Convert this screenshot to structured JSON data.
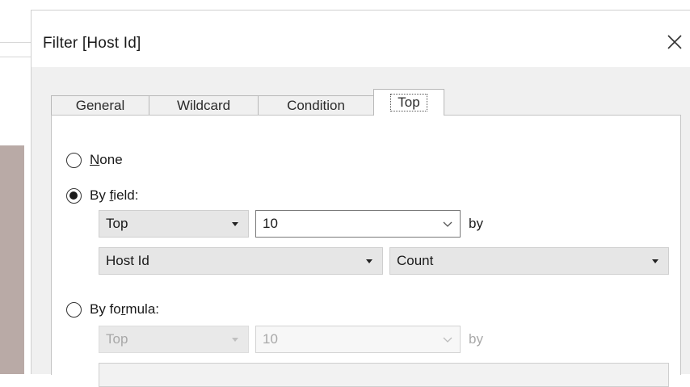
{
  "dialog": {
    "title": "Filter [Host Id]"
  },
  "tabs": [
    {
      "label": "General"
    },
    {
      "label": "Wildcard"
    },
    {
      "label": "Condition"
    },
    {
      "label": "Top",
      "active": true
    }
  ],
  "options": {
    "none": {
      "label_u": "N",
      "label_rest": "one"
    },
    "by_field": {
      "label_pre": "By ",
      "label_u": "f",
      "label_rest": "ield:",
      "checked": true
    },
    "by_formula": {
      "label_pre": "By fo",
      "label_u": "r",
      "label_rest": "mula:"
    }
  },
  "by_field": {
    "direction": "Top",
    "count": "10",
    "by_label": "by",
    "field": "Host Id",
    "aggregation": "Count"
  },
  "by_formula": {
    "direction": "Top",
    "count": "10",
    "by_label": "by"
  },
  "colors": {
    "dialog_bg": "#f0f0f0",
    "panel_bg": "#ffffff",
    "dropdown_bg": "#e6e6e6",
    "disabled_text": "#a8a8a8"
  }
}
